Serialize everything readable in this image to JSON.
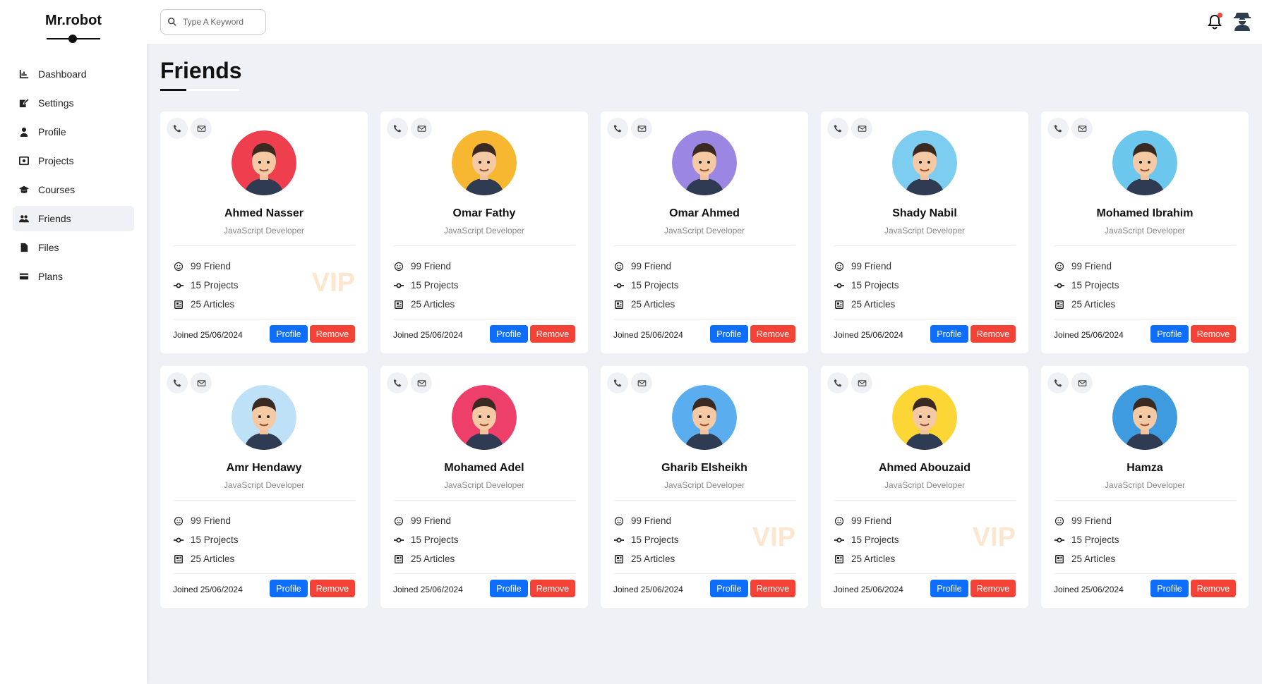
{
  "brand": {
    "title": "Mr.robot"
  },
  "sidebar": {
    "items": [
      {
        "label": "Dashboard",
        "icon": "chart-icon",
        "active": false
      },
      {
        "label": "Settings",
        "icon": "edit-icon",
        "active": false
      },
      {
        "label": "Profile",
        "icon": "user-icon",
        "active": false
      },
      {
        "label": "Projects",
        "icon": "project-icon",
        "active": false
      },
      {
        "label": "Courses",
        "icon": "graduation-cap-icon",
        "active": true
      },
      {
        "label": "Friends",
        "icon": "users-icon",
        "active": true
      },
      {
        "label": "Files",
        "icon": "file-icon",
        "active": false
      },
      {
        "label": "Plans",
        "icon": "credit-card-icon",
        "active": false
      }
    ]
  },
  "header": {
    "search_placeholder": "Type A Keyword"
  },
  "page": {
    "title": "Friends"
  },
  "friends": [
    {
      "name": "Ahmed Nasser",
      "role": "JavaScript Developer",
      "friends": "99 Friend",
      "projects": "15 Projects",
      "articles": "25 Articles",
      "joined": "Joined 25/06/2024",
      "vip": "VIP",
      "avatar_bg": "#ef3e4d"
    },
    {
      "name": "Omar Fathy",
      "role": "JavaScript Developer",
      "friends": "99 Friend",
      "projects": "15 Projects",
      "articles": "25 Articles",
      "joined": "Joined 25/06/2024",
      "vip": "",
      "avatar_bg": "#f7b731"
    },
    {
      "name": "Omar Ahmed",
      "role": "JavaScript Developer",
      "friends": "99 Friend",
      "projects": "15 Projects",
      "articles": "25 Articles",
      "joined": "Joined 25/06/2024",
      "vip": "",
      "avatar_bg": "#9b86e4"
    },
    {
      "name": "Shady Nabil",
      "role": "JavaScript Developer",
      "friends": "99 Friend",
      "projects": "15 Projects",
      "articles": "25 Articles",
      "joined": "Joined 25/06/2024",
      "vip": "",
      "avatar_bg": "#7ccdf0"
    },
    {
      "name": "Mohamed Ibrahim",
      "role": "JavaScript Developer",
      "friends": "99 Friend",
      "projects": "15 Projects",
      "articles": "25 Articles",
      "joined": "Joined 25/06/2024",
      "vip": "",
      "avatar_bg": "#6cc7ee"
    },
    {
      "name": "Amr Hendawy",
      "role": "JavaScript Developer",
      "friends": "99 Friend",
      "projects": "15 Projects",
      "articles": "25 Articles",
      "joined": "Joined 25/06/2024",
      "vip": "",
      "avatar_bg": "#bfe1f7"
    },
    {
      "name": "Mohamed Adel",
      "role": "JavaScript Developer",
      "friends": "99 Friend",
      "projects": "15 Projects",
      "articles": "25 Articles",
      "joined": "Joined 25/06/2024",
      "vip": "",
      "avatar_bg": "#ee3e6a"
    },
    {
      "name": "Gharib Elsheikh",
      "role": "JavaScript Developer",
      "friends": "99 Friend",
      "projects": "15 Projects",
      "articles": "25 Articles",
      "joined": "Joined 25/06/2024",
      "vip": "VIP",
      "avatar_bg": "#5aaef0"
    },
    {
      "name": "Ahmed Abouzaid",
      "role": "JavaScript Developer",
      "friends": "99 Friend",
      "projects": "15 Projects",
      "articles": "25 Articles",
      "joined": "Joined 25/06/2024",
      "vip": "VIP",
      "avatar_bg": "#fbd635"
    },
    {
      "name": "Hamza",
      "role": "JavaScript Developer",
      "friends": "99 Friend",
      "projects": "15 Projects",
      "articles": "25 Articles",
      "joined": "Joined 25/06/2024",
      "vip": "",
      "avatar_bg": "#3e9be0"
    }
  ],
  "buttons": {
    "profile": "Profile",
    "remove": "Remove"
  },
  "colors": {
    "primary": "#0d6efd",
    "danger": "#f44336",
    "background": "#eef1f5",
    "vip": "#fbe6cf"
  }
}
